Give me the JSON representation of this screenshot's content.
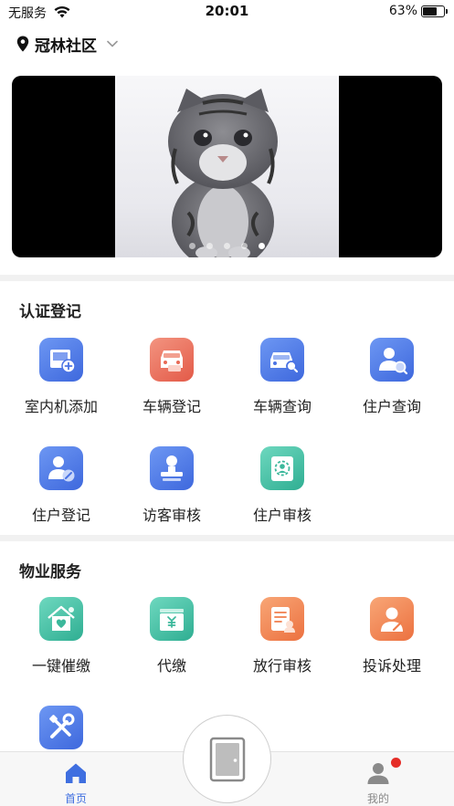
{
  "status_bar": {
    "carrier": "无服务",
    "time": "20:01",
    "battery": "63%",
    "battery_level": 0.63
  },
  "location": {
    "name": "冠林社区"
  },
  "banner": {
    "slide_count": 5,
    "active_index": 4
  },
  "sections": {
    "certification": {
      "title": "认证登记",
      "items": [
        {
          "label": "室内机添加",
          "icon": "indoor-unit-add-icon",
          "color": "#4a73e4"
        },
        {
          "label": "车辆登记",
          "icon": "vehicle-register-icon",
          "color": "#e86a55"
        },
        {
          "label": "车辆查询",
          "icon": "vehicle-query-icon",
          "color": "#4a73e4"
        },
        {
          "label": "住户查询",
          "icon": "resident-query-icon",
          "color": "#4a73e4"
        },
        {
          "label": "住户登记",
          "icon": "resident-register-icon",
          "color": "#4a73e4"
        },
        {
          "label": "访客审核",
          "icon": "visitor-review-icon",
          "color": "#4a73e4"
        },
        {
          "label": "住户审核",
          "icon": "resident-review-icon",
          "color": "#3bb89b"
        }
      ]
    },
    "property": {
      "title": "物业服务",
      "items": [
        {
          "label": "一键催缴",
          "icon": "one-click-reminder-icon",
          "color": "#3bb89b"
        },
        {
          "label": "代缴",
          "icon": "payment-icon",
          "color": "#3bb89b"
        },
        {
          "label": "放行审核",
          "icon": "release-review-icon",
          "color": "#f07d4b"
        },
        {
          "label": "投诉处理",
          "icon": "complaint-icon",
          "color": "#f07d4b"
        },
        {
          "label": "",
          "icon": "repair-tools-icon",
          "color": "#4a73e4"
        }
      ]
    }
  },
  "tabbar": {
    "home_label": "首页",
    "mine_label": "我的",
    "active_color": "#3f6fe0",
    "badge_color": "#e52d27"
  }
}
